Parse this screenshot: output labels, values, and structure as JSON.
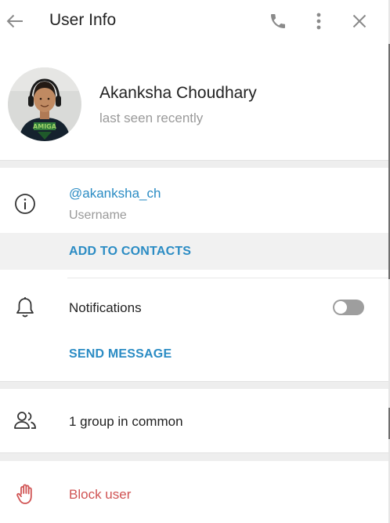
{
  "header": {
    "title": "User Info"
  },
  "profile": {
    "name": "Akanksha Choudhary",
    "status": "last seen recently"
  },
  "info": {
    "username": "@akanksha_ch",
    "username_label": "Username",
    "add_contacts": "ADD TO CONTACTS"
  },
  "notifications": {
    "label": "Notifications",
    "enabled": false,
    "send_message": "SEND MESSAGE"
  },
  "groups": {
    "label": "1 group in common"
  },
  "block": {
    "label": "Block user"
  },
  "icons": {
    "back": "arrow-left-icon",
    "call": "phone-icon",
    "more": "more-vertical-icon",
    "close": "close-icon",
    "info": "info-icon",
    "bell": "bell-icon",
    "group": "group-icon",
    "block": "hand-stop-icon"
  },
  "colors": {
    "accent": "#2b8cc4",
    "danger": "#d05353",
    "muted": "#9a9a9a"
  }
}
